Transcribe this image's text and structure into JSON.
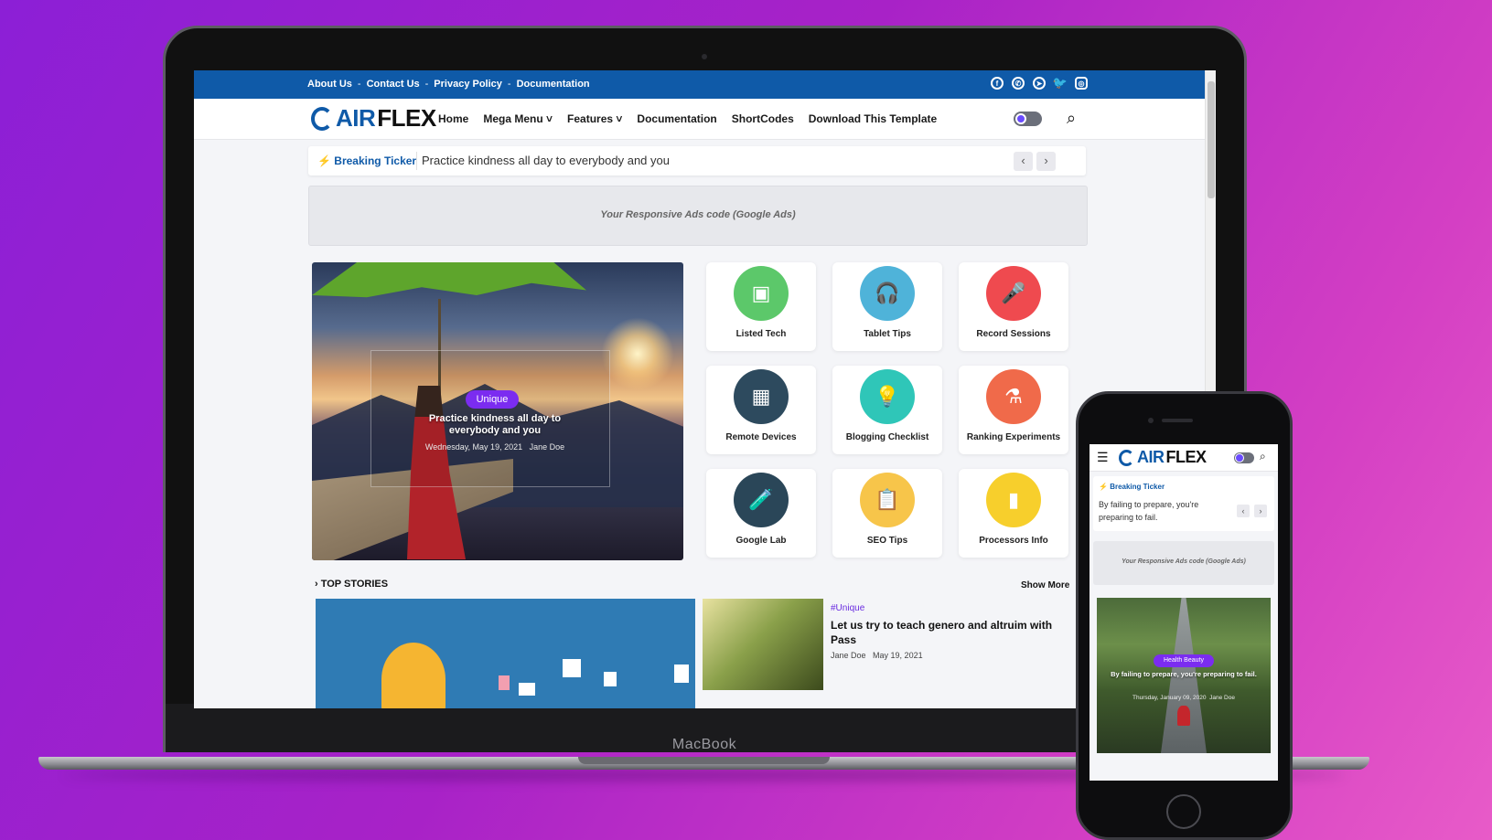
{
  "laptop": {
    "brand_label": "MacBook",
    "topbar": {
      "links": [
        "About Us",
        "Contact Us",
        "Privacy Policy",
        "Documentation"
      ],
      "separator": "-",
      "socials": [
        "facebook-icon",
        "whatsapp-icon",
        "telegram-icon",
        "twitter-icon",
        "instagram-icon"
      ]
    },
    "logo": {
      "part1": "AIR",
      "part2": "FLEX"
    },
    "nav": {
      "items": [
        "Home",
        "Mega Menu ˅",
        "Features ˅",
        "Documentation",
        "ShortCodes",
        "Download This Template"
      ]
    },
    "ticker": {
      "label": "Breaking Ticker",
      "text": "Practice kindness all day to everybody and you",
      "prev": "‹",
      "next": "›"
    },
    "ad": {
      "text": "Your Responsive Ads code (Google Ads)"
    },
    "hero": {
      "badge": "Unique",
      "title": "Practice kindness all day to everybody and you",
      "date": "Wednesday, May 19, 2021",
      "author": "Jane Doe"
    },
    "categories": [
      {
        "label": "Listed Tech",
        "icon": "tablet-icon",
        "color": "#5cc86a"
      },
      {
        "label": "Tablet Tips",
        "icon": "headphones-icon",
        "color": "#4fb3d9"
      },
      {
        "label": "Record Sessions",
        "icon": "microphone-icon",
        "color": "#ef4a4f"
      },
      {
        "label": "Remote Devices",
        "icon": "chip-icon",
        "color": "#2d4a5e"
      },
      {
        "label": "Blogging Checklist",
        "icon": "idea-head-icon",
        "color": "#2fc6b8"
      },
      {
        "label": "Ranking Experiments",
        "icon": "flask-icon",
        "color": "#f06a4a"
      },
      {
        "label": "Google Lab",
        "icon": "lab-icon",
        "color": "#2a4658"
      },
      {
        "label": "SEO Tips",
        "icon": "clipboard-icon",
        "color": "#f7c54a"
      },
      {
        "label": "Processors Info",
        "icon": "remote-icon",
        "color": "#f7cf2c"
      }
    ],
    "top_stories": {
      "heading": "› TOP STORIES",
      "show_more": "Show More",
      "story": {
        "tag": "#Unique",
        "title": "Let us try to teach genero and altruim with Pass",
        "author": "Jane Doe",
        "date": "May 19, 2021"
      }
    }
  },
  "phone": {
    "logo": {
      "part1": "AIR",
      "part2": "FLEX"
    },
    "ticker": {
      "label": "Breaking Ticker",
      "text": "By failing to prepare, you're preparing to fail.",
      "prev": "‹",
      "next": "›"
    },
    "ad": {
      "text": "Your Responsive Ads code (Google Ads)"
    },
    "hero": {
      "badge": "Health Beauty",
      "title": "By failing to prepare, you're preparing to fail.",
      "date": "Thursday, January 09, 2020",
      "author": "Jane Doe"
    }
  },
  "colors": {
    "brand_blue": "#0f5aa8",
    "accent_purple": "#7b2cf0"
  }
}
